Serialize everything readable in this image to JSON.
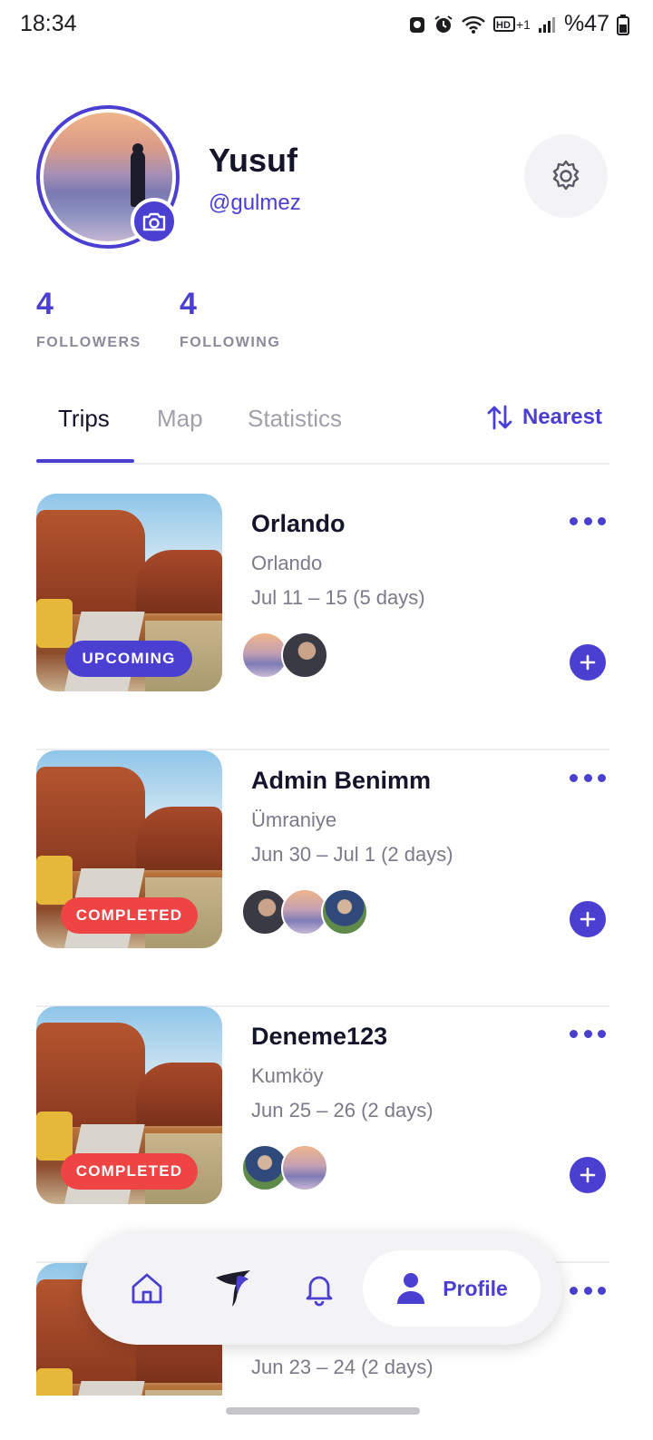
{
  "status_bar": {
    "time": "18:34",
    "battery": "%47"
  },
  "profile": {
    "name": "Yusuf",
    "handle": "@gulmez",
    "followers_count": "4",
    "followers_label": "FOLLOWERS",
    "following_count": "4",
    "following_label": "FOLLOWING"
  },
  "tabs": [
    {
      "label": "Trips",
      "active": true
    },
    {
      "label": "Map",
      "active": false
    },
    {
      "label": "Statistics",
      "active": false
    }
  ],
  "sort": {
    "label": "Nearest"
  },
  "trips": [
    {
      "title": "Orlando",
      "place": "Orlando",
      "dates": "Jul 11 – 15 (5 days)",
      "status": "UPCOMING"
    },
    {
      "title": "Admin Benimm",
      "place": "Ümraniye",
      "dates": "Jun 30 – Jul 1 (2 days)",
      "status": "COMPLETED"
    },
    {
      "title": "Deneme123",
      "place": "Kumköy",
      "dates": "Jun 25 – 26 (2 days)",
      "status": "COMPLETED"
    },
    {
      "title": "",
      "place": "",
      "dates": "Jun 23 – 24 (2 days)",
      "status": ""
    }
  ],
  "bottom_nav": {
    "items": [
      "home-icon",
      "logo-icon",
      "bell-icon",
      "person-icon"
    ],
    "active_label": "Profile"
  },
  "colors": {
    "accent": "#4a3fd1",
    "completed": "#ee4444",
    "muted": "#7a7a88"
  }
}
